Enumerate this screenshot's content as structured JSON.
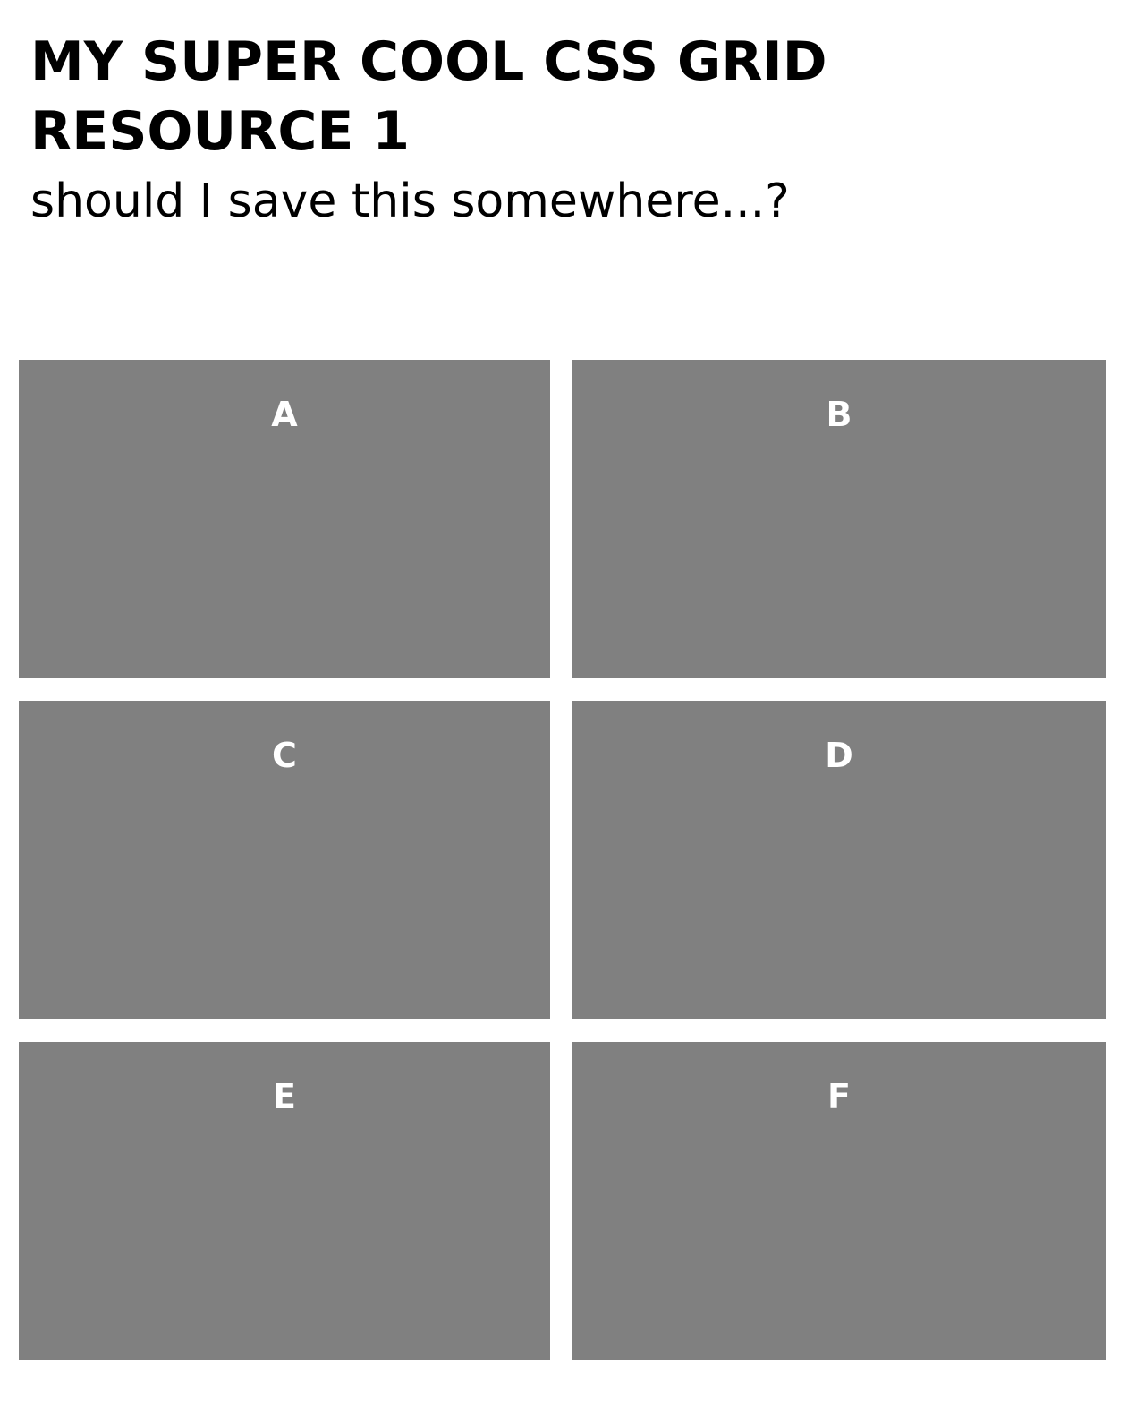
{
  "header": {
    "title": "MY SUPER COOL CSS GRID RESOURCE 1",
    "subtitle": "should I save this somewhere...?"
  },
  "colors": {
    "cell_background": "#808080",
    "cell_text": "#ffffff",
    "page_background": "#ffffff",
    "title_text": "#000000"
  },
  "grid": {
    "cells": [
      {
        "label": "A"
      },
      {
        "label": "B"
      },
      {
        "label": "C"
      },
      {
        "label": "D"
      },
      {
        "label": "E"
      },
      {
        "label": "F"
      }
    ]
  }
}
